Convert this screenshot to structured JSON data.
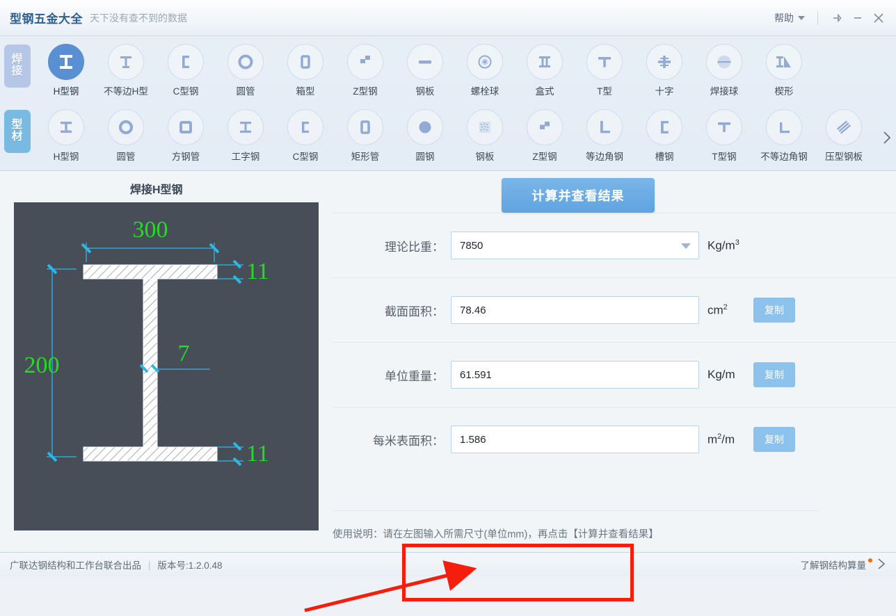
{
  "titlebar": {
    "title": "型钢五金大全",
    "subtitle": "天下没有查不到的数据",
    "help_label": "帮助",
    "icons": [
      "caret-down-icon",
      "pin-icon",
      "minimize-icon",
      "close-icon"
    ]
  },
  "toolbar": {
    "rows": [
      {
        "category": "焊接",
        "category_chars": [
          "焊",
          "接"
        ],
        "items": [
          {
            "label": "H型钢",
            "icon": "i-beam-icon",
            "active": true
          },
          {
            "label": "不等边H型",
            "icon": "unequal-h-icon",
            "active": false
          },
          {
            "label": "C型钢",
            "icon": "c-channel-icon",
            "active": false
          },
          {
            "label": "圆管",
            "icon": "round-pipe-icon",
            "active": false
          },
          {
            "label": "箱型",
            "icon": "box-section-icon",
            "active": false
          },
          {
            "label": "Z型钢",
            "icon": "z-section-icon",
            "active": false
          },
          {
            "label": "钢板",
            "icon": "steel-plate-icon",
            "active": false
          },
          {
            "label": "螺栓球",
            "icon": "bolt-ball-icon",
            "active": false
          },
          {
            "label": "盒式",
            "icon": "box-type-icon",
            "active": false
          },
          {
            "label": "T型",
            "icon": "t-section-icon",
            "active": false
          },
          {
            "label": "十字",
            "icon": "cross-section-icon",
            "active": false
          },
          {
            "label": "焊接球",
            "icon": "welded-ball-icon",
            "active": false
          },
          {
            "label": "楔形",
            "icon": "wedge-icon",
            "active": false
          }
        ]
      },
      {
        "category": "型材",
        "category_chars": [
          "型",
          "材"
        ],
        "items": [
          {
            "label": "H型钢",
            "icon": "i-beam-icon",
            "active": false
          },
          {
            "label": "圆管",
            "icon": "round-pipe-icon",
            "active": false
          },
          {
            "label": "方钢管",
            "icon": "square-tube-icon",
            "active": false
          },
          {
            "label": "工字钢",
            "icon": "i-beam-icon",
            "active": false
          },
          {
            "label": "C型钢",
            "icon": "c-channel-icon",
            "active": false
          },
          {
            "label": "矩形管",
            "icon": "rect-tube-icon",
            "active": false
          },
          {
            "label": "圆钢",
            "icon": "round-bar-icon",
            "active": false
          },
          {
            "label": "钢板",
            "icon": "checkered-plate-icon",
            "active": false
          },
          {
            "label": "Z型钢",
            "icon": "z-section-icon",
            "active": false
          },
          {
            "label": "等边角钢",
            "icon": "equal-angle-icon",
            "active": false
          },
          {
            "label": "槽钢",
            "icon": "channel-icon",
            "active": false
          },
          {
            "label": "T型钢",
            "icon": "t-section-icon",
            "active": false
          },
          {
            "label": "不等边角钢",
            "icon": "unequal-angle-icon",
            "active": false
          },
          {
            "label": "压型钢板",
            "icon": "profiled-plate-icon",
            "active": false
          }
        ]
      }
    ],
    "next_arrow_icon": "chevron-right-icon"
  },
  "main": {
    "diagram_title": "焊接H型钢",
    "diagram": {
      "width_label": "300",
      "height_label": "200",
      "top_flange_label": "11",
      "bottom_flange_label": "11",
      "web_label": "7",
      "dim_color": "#22dd22",
      "line_color": "#2bb7e8",
      "bg_color": "#474e58"
    },
    "calc_button": "计算并查看结果",
    "fields": [
      {
        "label": "理论比重：",
        "value": "7850",
        "unit_main": "Kg/m",
        "unit_sup": "3",
        "has_dropdown": true,
        "has_copy": false,
        "copy_label": "复制",
        "name": "density"
      },
      {
        "label": "截面面积：",
        "value": "78.46",
        "unit_main": "cm",
        "unit_sup": "2",
        "has_dropdown": false,
        "has_copy": true,
        "copy_label": "复制",
        "name": "section-area"
      },
      {
        "label": "单位重量：",
        "value": "61.591",
        "unit_main": "Kg/m",
        "unit_sup": "",
        "has_dropdown": false,
        "has_copy": true,
        "copy_label": "复制",
        "name": "unit-weight"
      },
      {
        "label": "每米表面积：",
        "value": "1.586",
        "unit_main": "m",
        "unit_sup": "2",
        "unit_tail": "/m",
        "has_dropdown": false,
        "has_copy": true,
        "copy_label": "复制",
        "name": "surface-area"
      }
    ],
    "hint": "使用说明：请在左图输入所需尺寸(单位mm)，再点击【计算并查看结果】",
    "annotation_color": "#f51e0c"
  },
  "statusbar": {
    "left": "广联达钢结构和工作台联合出品",
    "separator": "|",
    "version": "版本号:1.2.0.48",
    "right": "了解钢结构算量",
    "chevron_icon": "chevron-right-icon"
  }
}
